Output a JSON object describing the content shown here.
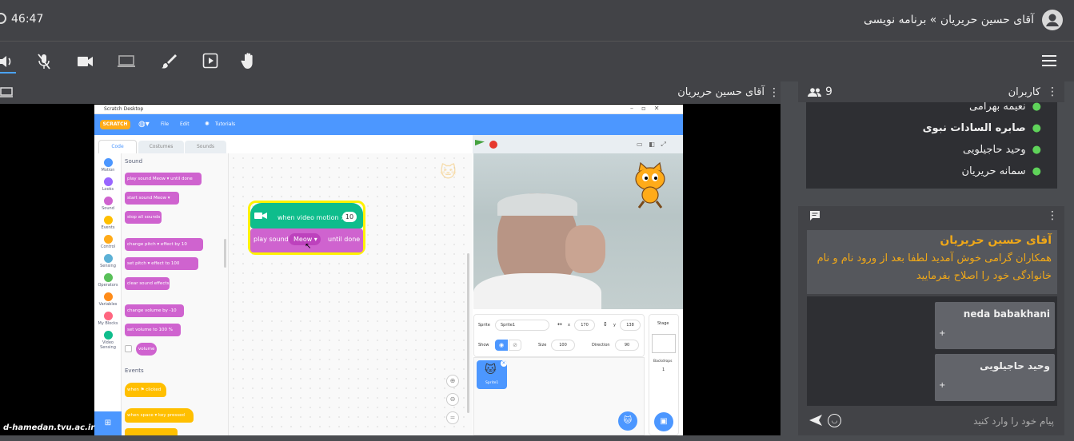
{
  "header": {
    "timer": "46:47",
    "room_title": "آقای حسین حریریان » برنامه نویسی"
  },
  "toolbar": {
    "icons": [
      "speaker-icon",
      "mic-off-icon",
      "camera-icon",
      "screen-share-icon",
      "brush-icon",
      "play-icon",
      "hand-icon"
    ],
    "menu_icon": "hamburger-icon"
  },
  "presenter_panel": {
    "title": "آقای حسین حریریان",
    "watermark": "d-hamedan.tvu.ac.ir"
  },
  "scratch": {
    "window_title": "Scratch Desktop",
    "menu": [
      "File",
      "Edit",
      "Tutorials"
    ],
    "tabs": [
      "Code",
      "Costumes",
      "Sounds"
    ],
    "categories": [
      {
        "label": "Motion",
        "color": "#4c97ff"
      },
      {
        "label": "Looks",
        "color": "#9966ff"
      },
      {
        "label": "Sound",
        "color": "#cf63cf"
      },
      {
        "label": "Events",
        "color": "#ffbf00"
      },
      {
        "label": "Control",
        "color": "#ffab19"
      },
      {
        "label": "Sensing",
        "color": "#5cb1d6"
      },
      {
        "label": "Operators",
        "color": "#59c059"
      },
      {
        "label": "Variables",
        "color": "#ff8c1a"
      },
      {
        "label": "My Blocks",
        "color": "#ff6680"
      },
      {
        "label": "Video Sensing",
        "color": "#0fbd8c"
      }
    ],
    "palette_heading_sound": "Sound",
    "palette_heading_events": "Events",
    "palette_blocks": [
      "play sound  Meow ▾  until done",
      "start sound  Meow ▾",
      "stop all sounds",
      "change  pitch ▾  effect by  10",
      "set  pitch ▾  effect to  100",
      "clear sound effects",
      "change volume by  -10",
      "set volume to  100  %",
      "volume"
    ],
    "event_blocks": [
      "when  ⚑  clicked",
      "when  space ▾  key pressed"
    ],
    "script_hat": "when video motion >",
    "script_hat_value": "10",
    "script_cmd": "play sound",
    "script_cmd_dropdown": "Meow",
    "script_cmd_suffix": "until done",
    "sprite_info": {
      "sprite_label": "Sprite",
      "sprite_name": "Sprite1",
      "x_label": "x",
      "x_value": "170",
      "y_label": "y",
      "y_value": "138",
      "show_label": "Show",
      "size_label": "Size",
      "size_value": "100",
      "direction_label": "Direction",
      "direction_value": "90",
      "stage_label": "Stage",
      "backdrops_label": "Backdrops",
      "backdrops_value": "1",
      "thumb_label": "Sprite1"
    }
  },
  "users_panel": {
    "title": "کاربران",
    "count": "9",
    "users": [
      "نعیمه بهرامی",
      "صابره السادات نبوی",
      "وحید حاجیلویی",
      "سمانه حریریان"
    ],
    "bold_index": 1
  },
  "chat_panel": {
    "pinned_author": "آقای حسین حریریان",
    "pinned_text": "همکاران گرامی خوش آمدید لطفا بعد از ورود نام و نام خانوادگی خود را اصلاح بفرمایید",
    "messages": [
      {
        "author": "neda babakhani",
        "body": "+"
      },
      {
        "author": "وحید حاجیلویی",
        "body": "+"
      }
    ],
    "input_placeholder": "پیام خود را وارد کنید"
  }
}
